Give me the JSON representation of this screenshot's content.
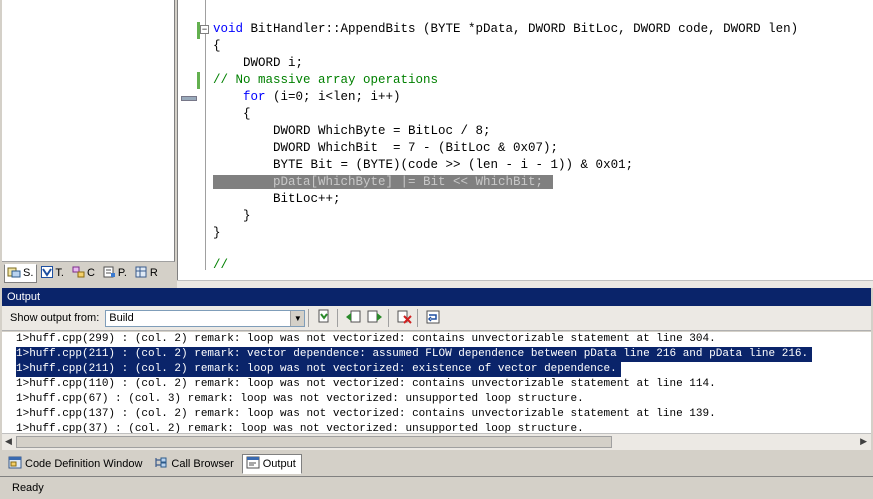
{
  "left_tabs": [
    {
      "label": "S.",
      "icon": "solution-icon"
    },
    {
      "label": "T.",
      "icon": "team-icon"
    },
    {
      "label": "C",
      "icon": "class-view-icon"
    },
    {
      "label": "P.",
      "icon": "property-icon"
    },
    {
      "label": "R",
      "icon": "resource-icon"
    }
  ],
  "code": {
    "signature_kw": "void",
    "signature_rest": " BitHandler::AppendBits (BYTE *pData, DWORD BitLoc, DWORD code, DWORD len)",
    "open_brace": "{",
    "decl": "    DWORD i;",
    "comment": "// No massive array operations",
    "for_kw": "for",
    "for_rest": " (i=0; i<len; i++)",
    "inner_open": "    {",
    "line1": "        DWORD WhichByte = BitLoc / 8;",
    "line2": "        DWORD WhichBit  = 7 - (BitLoc & 0x07);",
    "line3": "        BYTE Bit = (BYTE)(code >> (len - i - 1)) & 0x01;",
    "line4": "pData[WhichByte] |= Bit << WhichBit;",
    "line5": "        BitLoc++;",
    "inner_close": "    }",
    "close_brace": "}",
    "trailing": "//"
  },
  "output": {
    "title": "Output",
    "show_label": "Show output from:",
    "selected_source": "Build",
    "lines": [
      "1>huff.cpp(299) : (col. 2) remark: loop was not vectorized: contains unvectorizable statement at line 304.",
      "1>huff.cpp(211) : (col. 2) remark: vector dependence: assumed FLOW dependence between pData line 216 and pData line 216.",
      "1>huff.cpp(211) : (col. 2) remark: loop was not vectorized: existence of vector dependence.",
      "1>huff.cpp(110) : (col. 2) remark: loop was not vectorized: contains unvectorizable statement at line 114.",
      "1>huff.cpp(67) : (col. 3) remark: loop was not vectorized: unsupported loop structure.",
      "1>huff.cpp(137) : (col. 2) remark: loop was not vectorized: contains unvectorizable statement at line 139.",
      "1>huff.cpp(37) : (col. 2) remark: loop was not vectorized: unsupported loop structure."
    ]
  },
  "bottom_tabs": [
    {
      "label": "Code Definition Window"
    },
    {
      "label": "Call Browser"
    },
    {
      "label": "Output"
    }
  ],
  "status": "Ready"
}
